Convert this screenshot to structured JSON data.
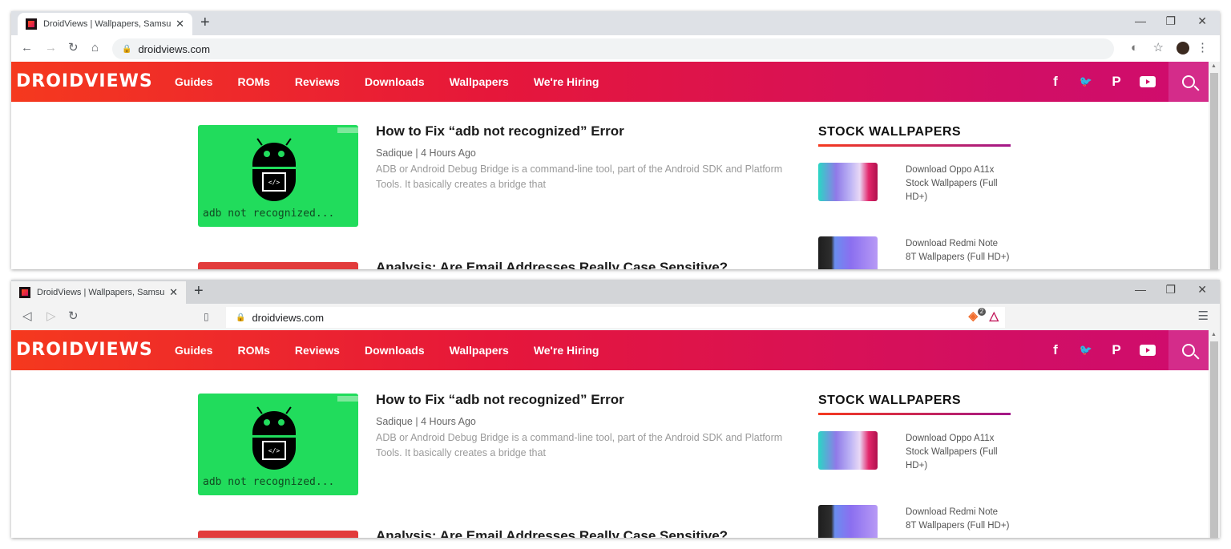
{
  "windows": [
    {
      "browser": "Chrome",
      "tab": {
        "title": "DroidViews | Wallpapers, Samsung Ca",
        "close": "✕"
      },
      "new_tab": "+",
      "controls": {
        "minimize": "—",
        "restore": "❐",
        "close": "✕"
      },
      "toolbar": {
        "back": "←",
        "forward": "→",
        "reload": "↻",
        "home": "⌂",
        "url": "droidviews.com",
        "extension_icon": "◐",
        "star": "☆",
        "menu": "⋮"
      }
    },
    {
      "browser": "Brave",
      "tab": {
        "title": "DroidViews | Wallpapers, Samsung Ca",
        "close": "✕"
      },
      "new_tab": "+",
      "controls": {
        "minimize": "—",
        "restore": "❐",
        "close": "✕"
      },
      "toolbar": {
        "back": "◁",
        "forward": "▷",
        "reload": "↻",
        "bookmark": "🔖",
        "url": "droidviews.com",
        "shields_badge": "2",
        "rewards": "△",
        "menu": "☰"
      }
    }
  ],
  "site": {
    "logo": "DROIDVIEWS",
    "nav": [
      "Guides",
      "ROMs",
      "Reviews",
      "Downloads",
      "Wallpapers",
      "We're Hiring"
    ],
    "social": {
      "facebook": "f",
      "twitter": "🐦",
      "pinterest": "P"
    },
    "posts": [
      {
        "thumb_caption": "adb not recognized...",
        "thumb_code": "</>",
        "title": "How to Fix “adb not recognized” Error",
        "meta": "Sadique | 4 Hours Ago",
        "excerpt": "ADB or Android Debug Bridge is a command-line tool, part of the Android SDK and Platform Tools. It basically creates a bridge that"
      },
      {
        "title": "Analysis: Are Email Addresses Really Case Sensitive?"
      }
    ],
    "sidebar": {
      "heading": "STOCK WALLPAPERS",
      "items": [
        {
          "title": "Download Oppo A11x Stock Wallpapers (Full HD+)"
        },
        {
          "title": "Download Redmi Note 8T Wallpapers (Full HD+)"
        }
      ]
    }
  },
  "colors": {
    "nav_start": "#f5391e",
    "nav_end": "#cf0c6e",
    "search_bg": "#d42c8a",
    "thumb_green": "#21dc5c"
  }
}
